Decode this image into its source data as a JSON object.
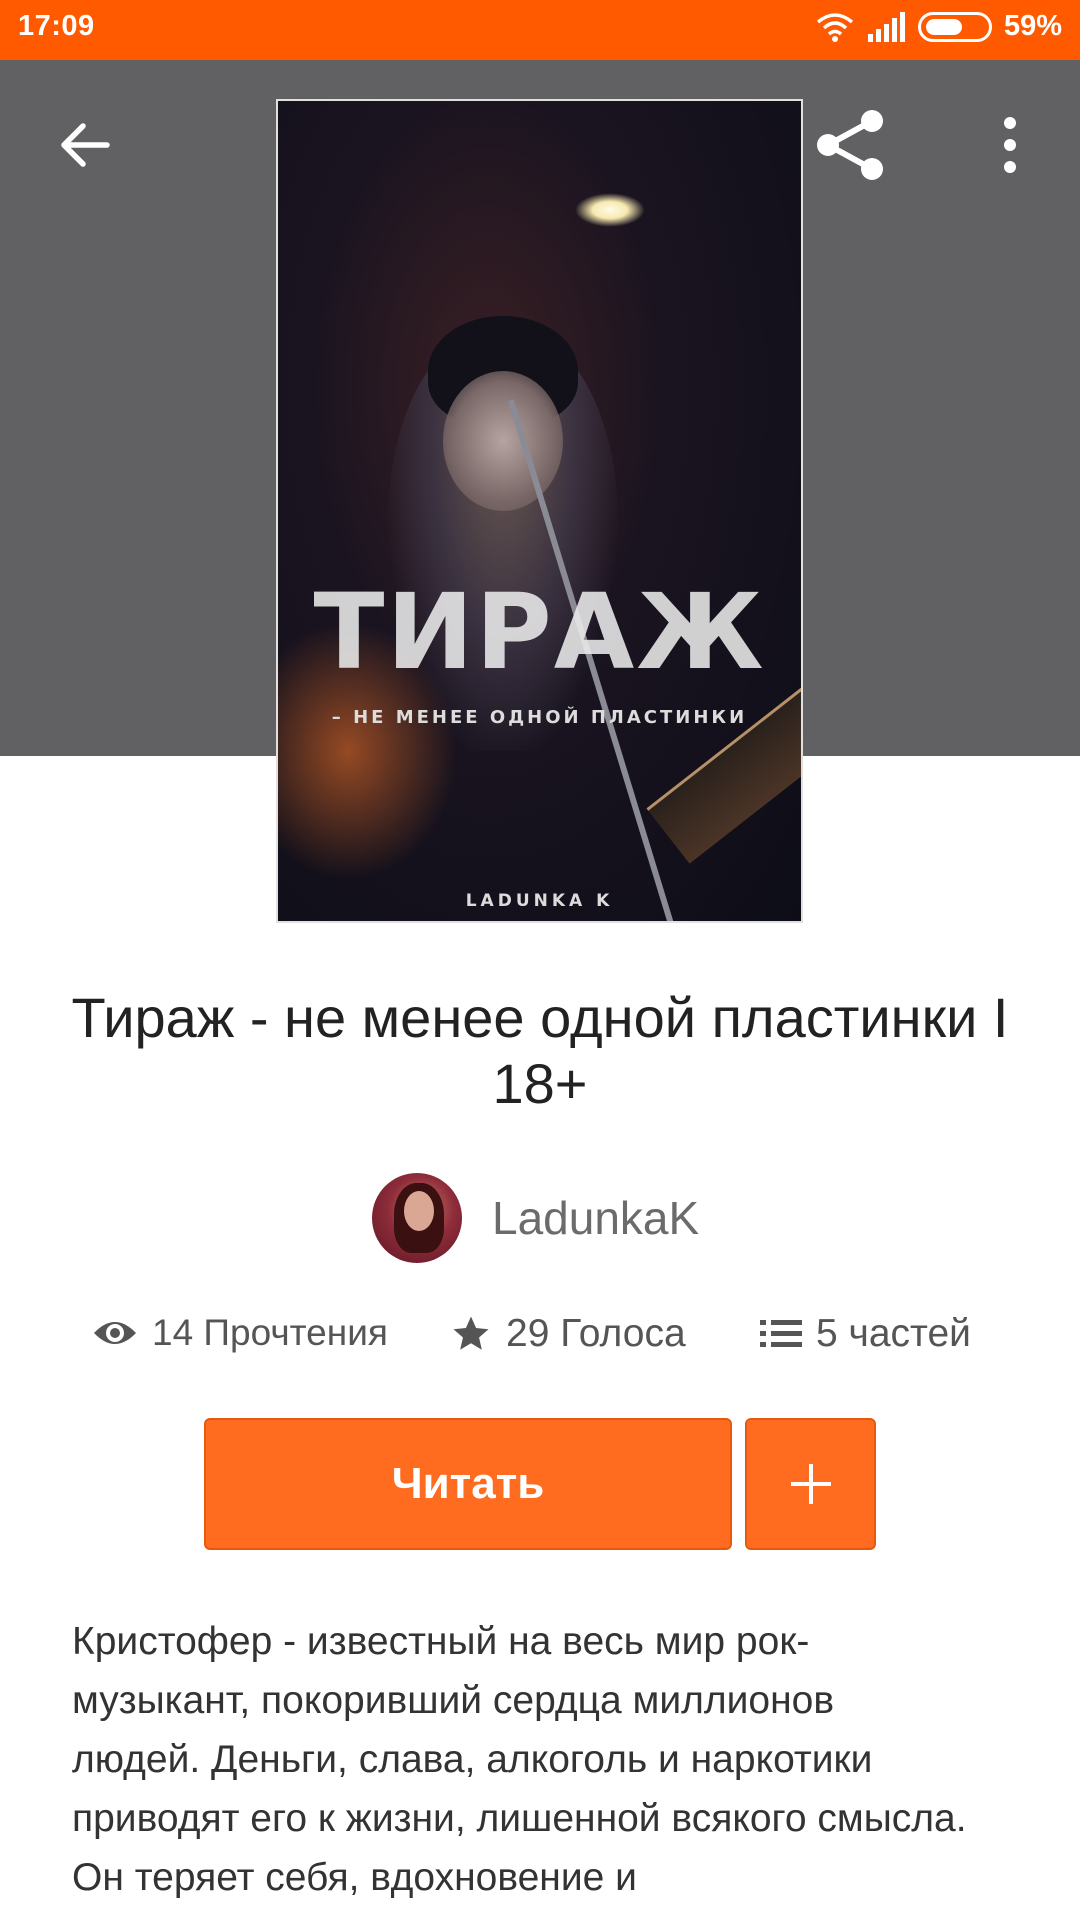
{
  "status_bar": {
    "time": "17:09",
    "battery_percent": "59%",
    "icons": [
      "wifi-icon",
      "signal-icon",
      "battery-icon"
    ]
  },
  "header": {
    "background_color": "#616163",
    "icons": [
      "back-arrow-icon",
      "share-icon",
      "more-vert-icon"
    ]
  },
  "cover": {
    "title": "ТИРАЖ",
    "subtitle": "– НЕ МЕНЕЕ ОДНОЙ ПЛАСТИНКИ",
    "author": "LADUNKA K"
  },
  "story": {
    "title": "Тираж - не менее одной пластинки I 18+",
    "author": "LadunkaK"
  },
  "stats": {
    "reads": "14 Прочтения",
    "votes": "29 Голоса",
    "parts": "5 частей"
  },
  "actions": {
    "read_label": "Читать",
    "add_label": "+"
  },
  "description": "Кристофер - известный на весь мир рок-музыкант, покоривший сердца миллионов людей. Деньги, слава, алкоголь и наркотики приводят его к жизни, лишенной всякого смысла. Он теряет себя, вдохновение и",
  "colors": {
    "accent": "#ff6b1f",
    "status_bar": "#ff5a00"
  }
}
